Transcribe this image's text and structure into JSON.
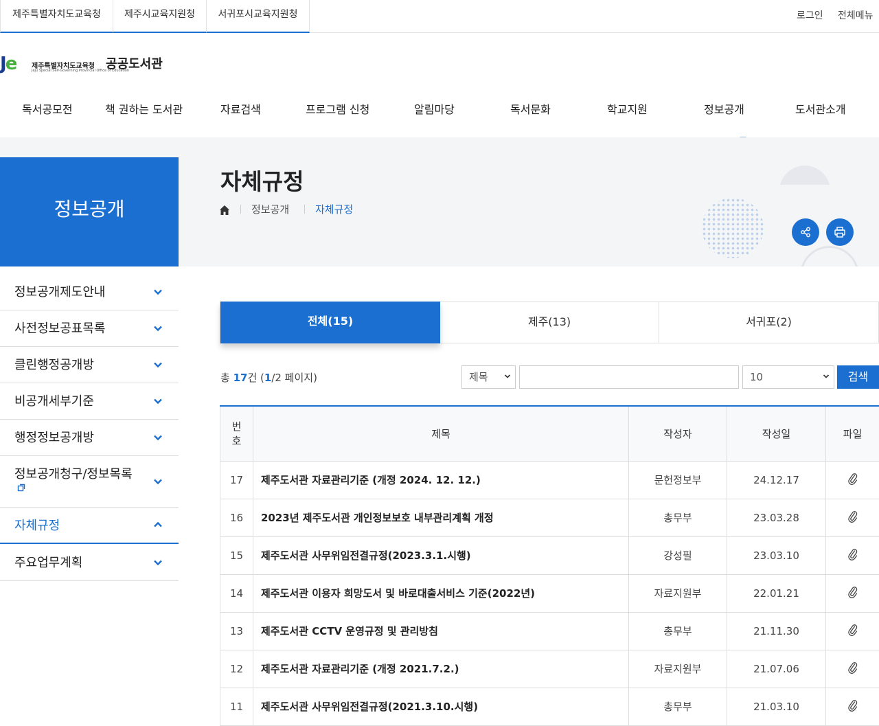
{
  "top_tabs": [
    "제주특별자치도교육청",
    "제주시교육지원청",
    "서귀포시교육지원청"
  ],
  "top_links": {
    "login": "로그인",
    "menu": "전체메뉴"
  },
  "logo": {
    "mark_b": "J",
    "mark_g": "e",
    "org": "제주특별자치도교육청",
    "org_en": "Jeju Special Self-Governing Provincial Office of Education",
    "name": "공공도서관"
  },
  "gnb": [
    "독서공모전",
    "책 권하는 도서관",
    "자료검색",
    "프로그램 신청",
    "알림마당",
    "독서문화",
    "학교지원",
    "정보공개",
    "도서관소개"
  ],
  "side_title": "정보공개",
  "page_title": "자체규정",
  "breadcrumb": [
    "정보공개",
    "자체규정"
  ],
  "side_menu": [
    {
      "label": "정보공개제도안내",
      "open": false
    },
    {
      "label": "사전정보공표목록",
      "open": false
    },
    {
      "label": "클린행정공개방",
      "open": false
    },
    {
      "label": "비공개세부기준",
      "open": false
    },
    {
      "label": "행정정보공개방",
      "open": false
    },
    {
      "label": "정보공개청구/정보목록",
      "open": false,
      "external": true
    },
    {
      "label": "자체규정",
      "open": true,
      "active": true
    },
    {
      "label": "주요업무계획",
      "open": false
    }
  ],
  "tabs": [
    "전체(15)",
    "제주(13)",
    "서귀포(2)"
  ],
  "summary": {
    "prefix": "총 ",
    "count": "17",
    "unit": "건 (",
    "page": "1",
    "pages": "/2 페이지)"
  },
  "search": {
    "field": "제목",
    "size": "10",
    "button": "검색"
  },
  "table": {
    "headers": [
      "번호",
      "제목",
      "작성자",
      "작성일",
      "파일"
    ],
    "rows": [
      {
        "no": "17",
        "title": "제주도서관 자료관리기준 (개정 2024. 12. 12.)",
        "author": "문헌정보부",
        "date": "24.12.17"
      },
      {
        "no": "16",
        "title": "2023년 제주도서관 개인정보보호 내부관리계획 개정",
        "author": "총무부",
        "date": "23.03.28"
      },
      {
        "no": "15",
        "title": "제주도서관 사무위임전결규정(2023.3.1.시행)",
        "author": "강성필",
        "date": "23.03.10"
      },
      {
        "no": "14",
        "title": "제주도서관 이용자 희망도서 및 바로대출서비스 기준(2022년)",
        "author": "자료지원부",
        "date": "22.01.21"
      },
      {
        "no": "13",
        "title": "제주도서관 CCTV 운영규정 및 관리방침",
        "author": "총무부",
        "date": "21.11.30"
      },
      {
        "no": "12",
        "title": "제주도서관 자료관리기준 (개정 2021.7.2.)",
        "author": "자료지원부",
        "date": "21.07.06"
      },
      {
        "no": "11",
        "title": "제주도서관 사무위임전결규정(2021.3.10.시행)",
        "author": "총무부",
        "date": "21.03.10"
      }
    ]
  },
  "colors": {
    "accent": "#1b6fd0",
    "hero_bg": "#f4f5f7"
  }
}
